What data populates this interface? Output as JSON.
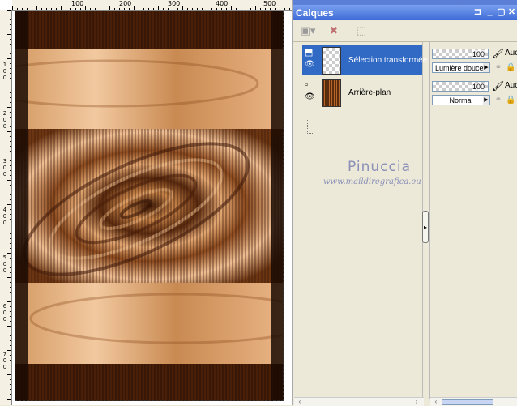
{
  "ruler": {
    "top_labels": [
      "100",
      "200",
      "300",
      "400",
      "500"
    ],
    "left_labels": [
      "1\n0\n0",
      "2\n0\n0",
      "3\n0\n0",
      "4\n0\n0",
      "5\n0\n0",
      "6\n0\n0",
      "7\n0\n0"
    ]
  },
  "palette": {
    "title": "Calques",
    "title_buttons": [
      "⊐",
      "_",
      "▢",
      "✕"
    ]
  },
  "toolbar": {
    "tools": [
      {
        "name": "new-layer-tool",
        "icon": "new-layer-icon",
        "glyph": "▣▾"
      },
      {
        "name": "delete-layer-tool",
        "icon": "delete-icon",
        "glyph": "✖"
      },
      {
        "name": "edit-selection-tool",
        "icon": "edit-selection-icon",
        "glyph": "⬚"
      }
    ]
  },
  "layers": [
    {
      "name": "Sélection transformée",
      "opacity": "100",
      "blend": "Lumière douce",
      "selected": true
    },
    {
      "name": "Arrière-plan",
      "opacity": "100",
      "blend": "Normal",
      "selected": false
    }
  ],
  "props": {
    "aux_label": "Auc"
  },
  "watermark": {
    "name": "Pinuccia",
    "url": "www.maildiregrafica.eu"
  },
  "colors": {
    "selection": "#316ac5",
    "title_start": "#7aa0ee",
    "title_end": "#3d6bd8",
    "watermark": "#8a8fb8"
  }
}
